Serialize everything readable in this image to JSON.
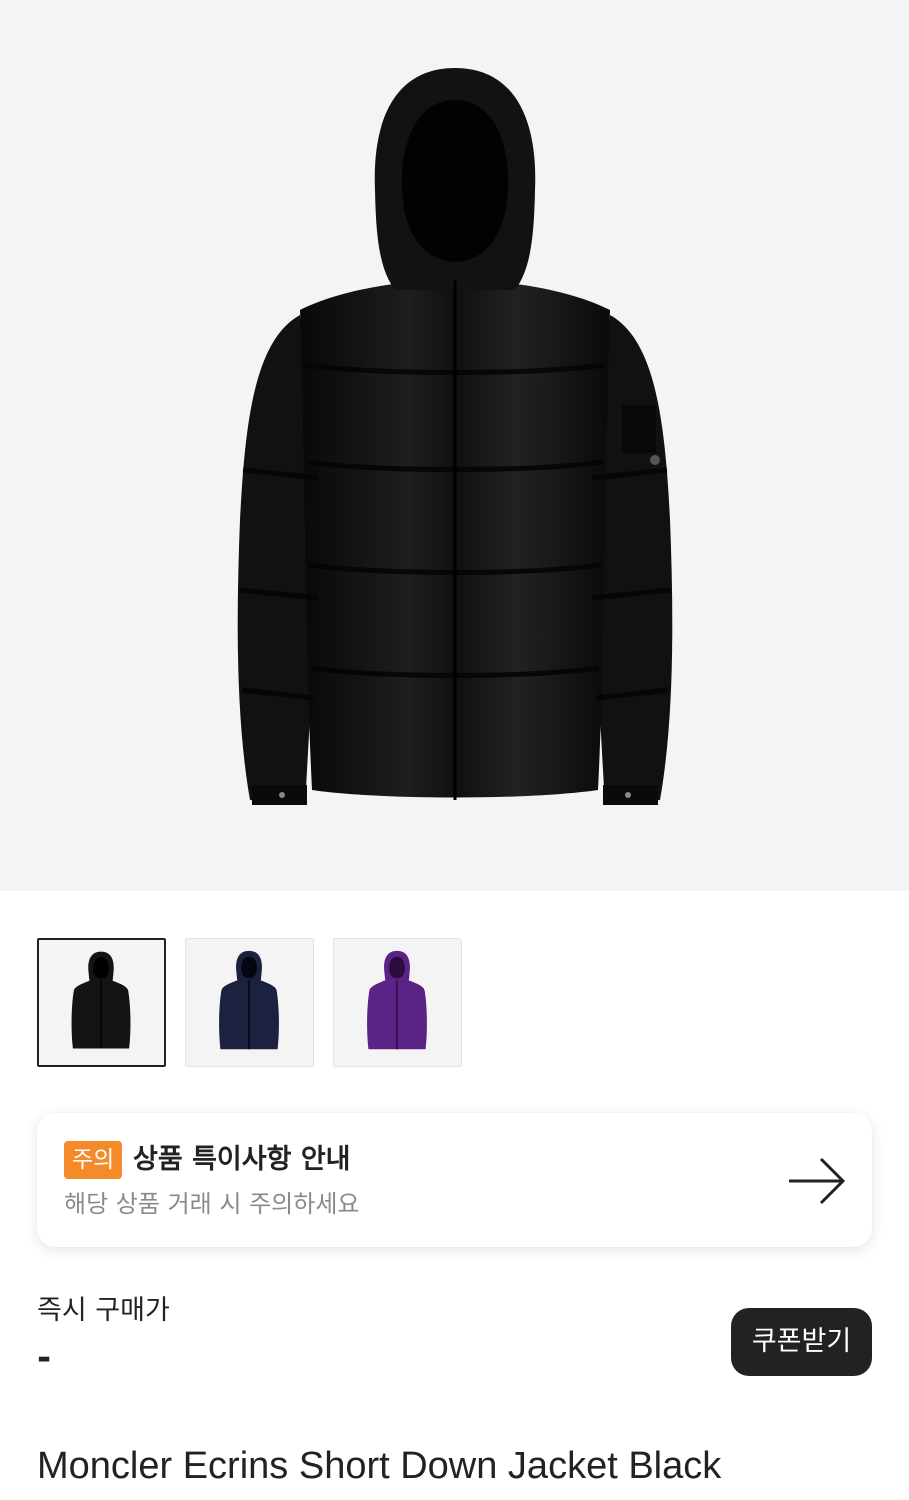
{
  "product": {
    "name": "Moncler Ecrins Short Down Jacket Black",
    "main_image_icon": "black-down-jacket-image"
  },
  "thumbnails": [
    {
      "icon": "black-jacket-thumbnail",
      "color": "#141414",
      "selected": true
    },
    {
      "icon": "navy-jacket-thumbnail",
      "color": "#1c2140",
      "selected": false
    },
    {
      "icon": "purple-jacket-thumbnail",
      "color": "#5c2386",
      "selected": false
    }
  ],
  "notice": {
    "badge": "주의",
    "title": "상품 특이사항 안내",
    "subtitle": "해당 상품 거래 시 주의하세요",
    "arrow_icon": "arrow-right-icon",
    "badge_color": "#f58a2a"
  },
  "price": {
    "label": "즉시 구매가",
    "value": "-"
  },
  "coupon_button": {
    "label": "쿠폰받기"
  }
}
